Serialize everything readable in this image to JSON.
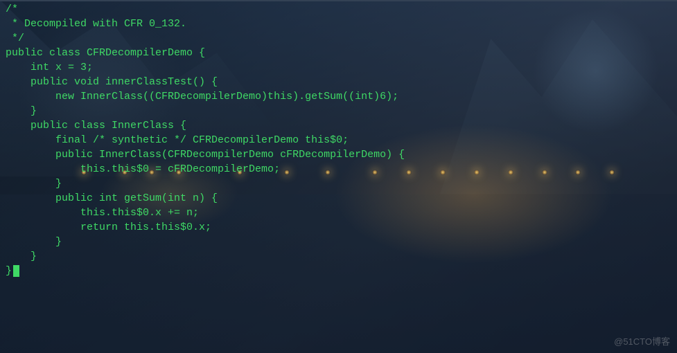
{
  "code": {
    "lines": [
      "/*",
      " * Decompiled with CFR 0_132.",
      " */",
      "public class CFRDecompilerDemo {",
      "    int x = 3;",
      "",
      "    public void innerClassTest() {",
      "        new InnerClass((CFRDecompilerDemo)this).getSum((int)6);",
      "    }",
      "",
      "    public class InnerClass {",
      "        final /* synthetic */ CFRDecompilerDemo this$0;",
      "",
      "        public InnerClass(CFRDecompilerDemo cFRDecompilerDemo) {",
      "            this.this$0 = cFRDecompilerDemo;",
      "        }",
      "",
      "        public int getSum(int n) {",
      "            this.this$0.x += n;",
      "            return this.this$0.x;",
      "        }",
      "    }",
      "",
      "}"
    ]
  },
  "watermark": "@51CTO博客",
  "theme": {
    "text_color": "#3fd965",
    "cursor_color": "#3fd965"
  }
}
